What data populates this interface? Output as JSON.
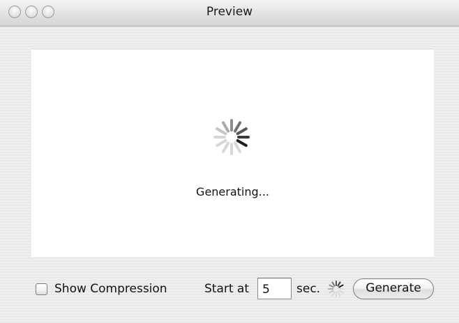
{
  "window": {
    "title": "Preview"
  },
  "preview": {
    "status_text": "Generating...",
    "spinner_icon": "loading-spinner-icon"
  },
  "controls": {
    "show_compression": {
      "label": "Show Compression",
      "checked": false
    },
    "start_at": {
      "label": "Start at",
      "value": "5",
      "unit_label": "sec."
    },
    "progress_icon": "small-spinner-icon",
    "generate_label": "Generate"
  }
}
